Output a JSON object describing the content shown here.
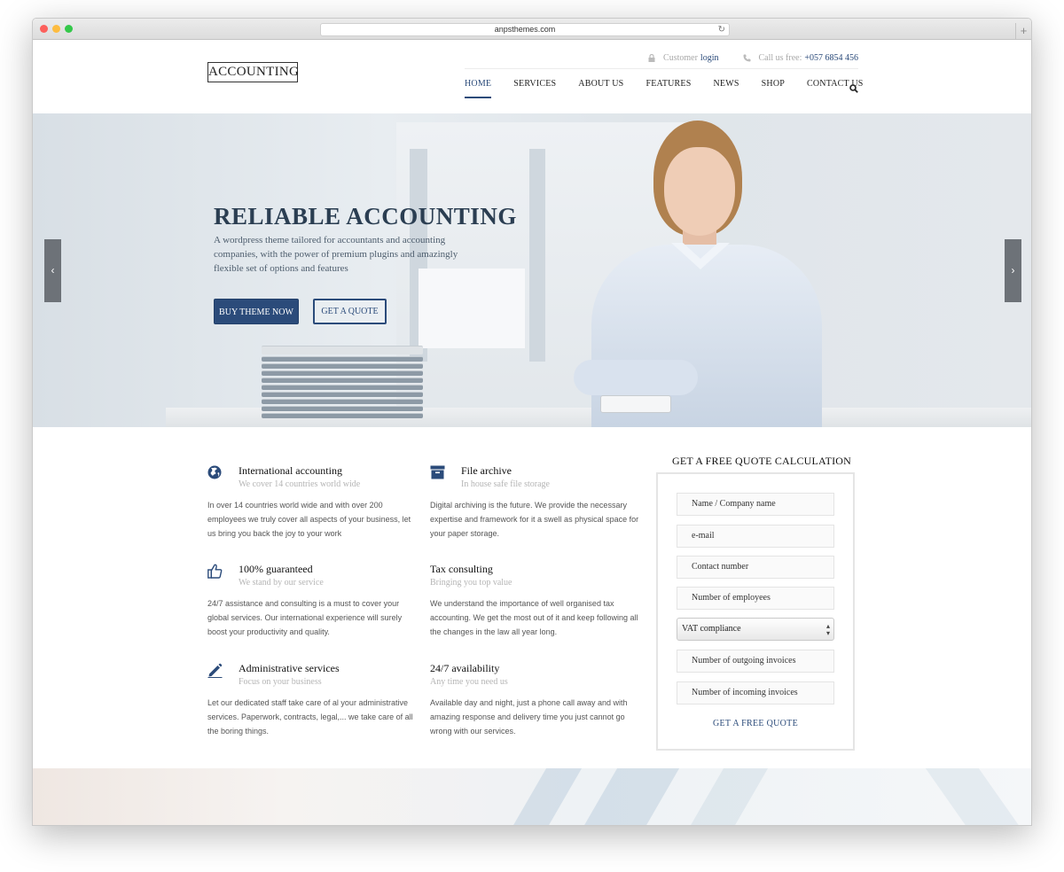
{
  "browser": {
    "url": "anpsthemes.com"
  },
  "header": {
    "logo": "ACCOUNTING",
    "customer": "Customer",
    "login": "login",
    "call_label": "Call us free:",
    "phone": "+057 6854 456"
  },
  "nav": {
    "items": [
      {
        "label": "HOME",
        "active": true
      },
      {
        "label": "SERVICES"
      },
      {
        "label": "ABOUT US"
      },
      {
        "label": "FEATURES"
      },
      {
        "label": "NEWS"
      },
      {
        "label": "SHOP"
      },
      {
        "label": "CONTACT US"
      }
    ]
  },
  "hero": {
    "title": "RELIABLE ACCOUNTING",
    "text": "A wordpress theme tailored for accountants and accounting companies, with the power of premium plugins and amazingly flexible set of options and features",
    "primary_button": "BUY THEME NOW",
    "secondary_button": "GET A QUOTE",
    "prev_arrow": "‹",
    "next_arrow": "›"
  },
  "features": [
    {
      "icon": "globe-icon",
      "title": "International accounting",
      "subtitle": "We cover 14 countries world wide",
      "text": "In over 14 countries world wide and with over 200 employees we truly cover all aspects of your business, let us bring you back the joy to your work"
    },
    {
      "icon": "archive-icon",
      "title": "File archive",
      "subtitle": "In house safe file storage",
      "text": "Digital archiving is the future. We provide the necessary expertise and framework for it a swell as physical space for your paper storage."
    },
    {
      "icon": "thumbs-up-icon",
      "title": "100% guaranteed",
      "subtitle": "We stand by our service",
      "text": "24/7 assistance and consulting is a must to cover your global services. Our international experience will surely boost your productivity and quality."
    },
    {
      "icon": "",
      "title": "Tax consulting",
      "subtitle": "Bringing you top value",
      "text": "We understand the importance of well organised tax accounting. We get the most out of it and keep following all the changes in the law all year long."
    },
    {
      "icon": "pencil-icon",
      "title": "Administrative services",
      "subtitle": "Focus on your business",
      "text": "Let our dedicated staff take care of al your administrative services. Paperwork, contracts, legal,... we take care of all the boring things."
    },
    {
      "icon": "",
      "title": "24/7 availability",
      "subtitle": "Any time you need us",
      "text": "Available day and night, just a phone call away and with amazing response and delivery time you just cannot go wrong with our services."
    }
  ],
  "quote": {
    "title": "GET A FREE QUOTE CALCULATION",
    "fields": [
      "Name / Company name",
      "e-mail",
      "Contact number",
      "Number of employees"
    ],
    "select_value": "VAT compliance",
    "fields_after": [
      "Number of outgoing invoices",
      "Number of incoming invoices"
    ],
    "submit": "GET A FREE QUOTE"
  },
  "colors": {
    "accent": "#2b4b7a",
    "hero_title": "#2b3e52"
  }
}
